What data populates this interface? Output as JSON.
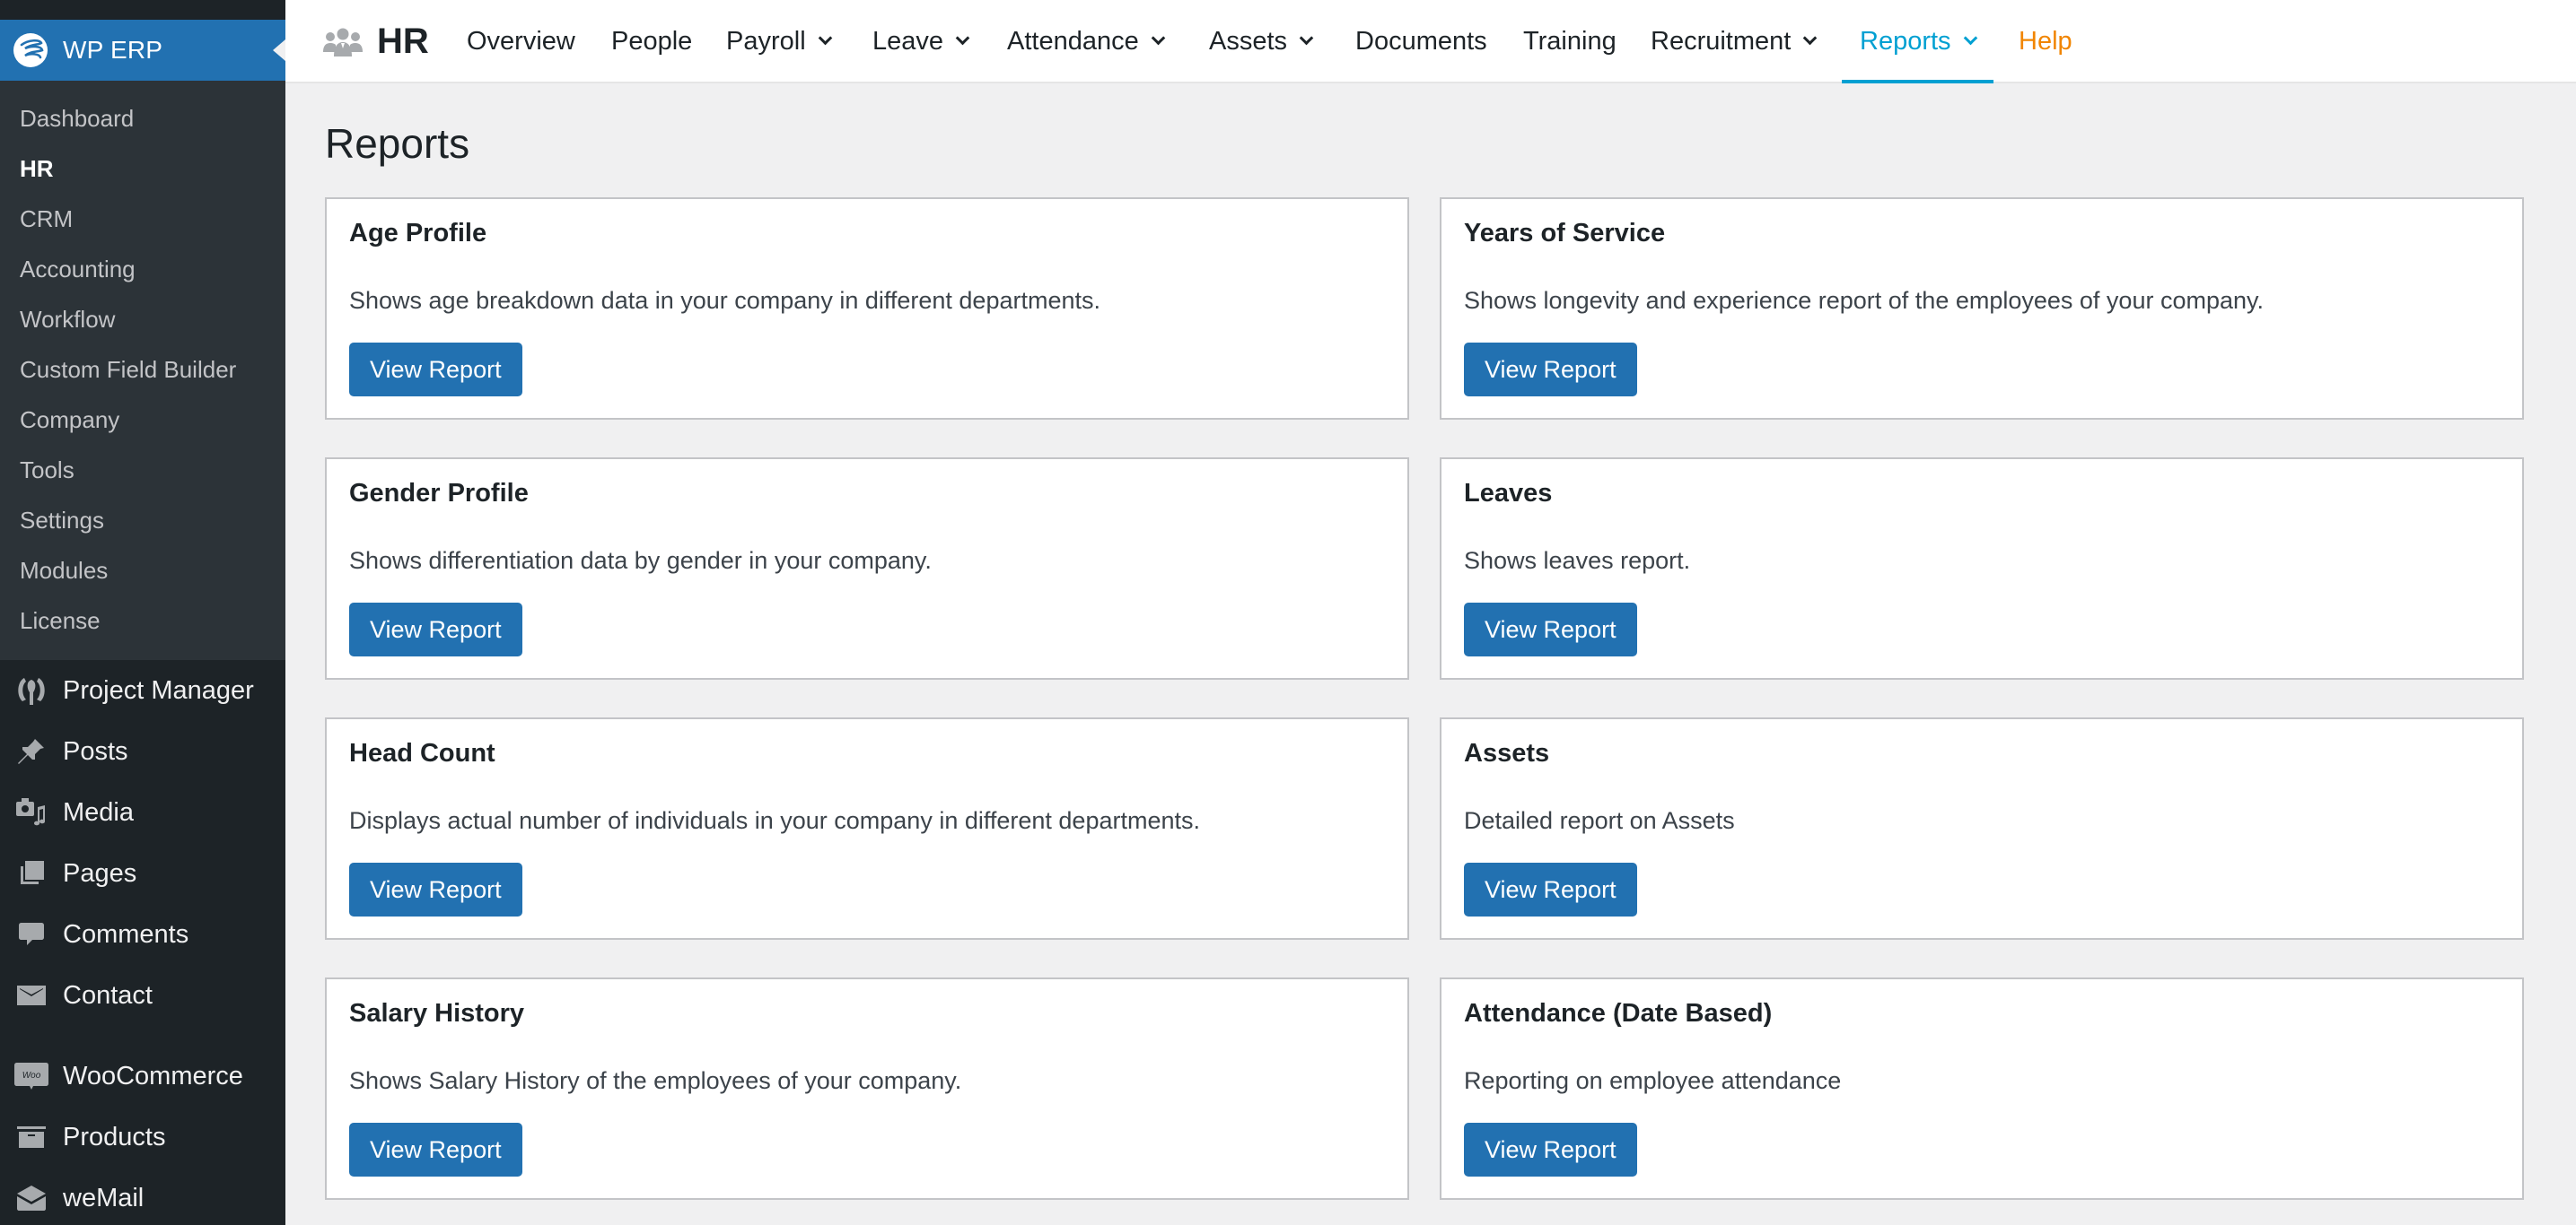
{
  "sidebar": {
    "erp_menu": {
      "label": "WP ERP",
      "icon": "wp-erp-logo-icon"
    },
    "submenu": [
      {
        "label": "Dashboard"
      },
      {
        "label": "HR",
        "current": true
      },
      {
        "label": "CRM"
      },
      {
        "label": "Accounting"
      },
      {
        "label": "Workflow"
      },
      {
        "label": "Custom Field Builder"
      },
      {
        "label": "Company"
      },
      {
        "label": "Tools"
      },
      {
        "label": "Settings"
      },
      {
        "label": "Modules"
      },
      {
        "label": "License"
      }
    ],
    "menu": [
      {
        "label": "Project Manager",
        "icon": "project-manager-icon"
      },
      {
        "label": "Posts",
        "icon": "pushpin-icon"
      },
      {
        "label": "Media",
        "icon": "media-icon"
      },
      {
        "label": "Pages",
        "icon": "pages-icon"
      },
      {
        "label": "Comments",
        "icon": "comment-icon"
      },
      {
        "label": "Contact",
        "icon": "envelope-icon"
      },
      {
        "label": "WooCommerce",
        "icon": "woocommerce-icon"
      },
      {
        "label": "Products",
        "icon": "archive-box-icon"
      },
      {
        "label": "weMail",
        "icon": "wemail-icon"
      }
    ]
  },
  "header": {
    "brand": "HR",
    "brand_icon": "people-group-icon",
    "nav": [
      {
        "label": "Overview",
        "dropdown": false
      },
      {
        "label": "People",
        "dropdown": false
      },
      {
        "label": "Payroll",
        "dropdown": true
      },
      {
        "label": "Leave",
        "dropdown": true
      },
      {
        "label": "Attendance",
        "dropdown": true
      },
      {
        "label": "Assets",
        "dropdown": true
      },
      {
        "label": "Documents",
        "dropdown": false
      },
      {
        "label": "Training",
        "dropdown": false
      },
      {
        "label": "Recruitment",
        "dropdown": true
      },
      {
        "label": "Reports",
        "dropdown": true,
        "active": true
      },
      {
        "label": "Help",
        "dropdown": false
      }
    ]
  },
  "colors": {
    "accent": "#00a0d2",
    "help": "#f18500",
    "button": "#2271b1",
    "sidebar_bg": "#1d2327",
    "submenu_bg": "#2c3338"
  },
  "main": {
    "title": "Reports",
    "reports": [
      {
        "title": "Age Profile",
        "description": "Shows age breakdown data in your company in different departments.",
        "button": "View Report"
      },
      {
        "title": "Years of Service",
        "description": "Shows longevity and experience report of the employees of your company.",
        "button": "View Report"
      },
      {
        "title": "Gender Profile",
        "description": "Shows differentiation data by gender in your company.",
        "button": "View Report"
      },
      {
        "title": "Leaves",
        "description": "Shows leaves report.",
        "button": "View Report"
      },
      {
        "title": "Head Count",
        "description": "Displays actual number of individuals in your company in different departments.",
        "button": "View Report"
      },
      {
        "title": "Assets",
        "description": "Detailed report on Assets",
        "button": "View Report"
      },
      {
        "title": "Salary History",
        "description": "Shows Salary History of the employees of your company.",
        "button": "View Report"
      },
      {
        "title": "Attendance (Date Based)",
        "description": "Reporting on employee attendance",
        "button": "View Report"
      }
    ]
  }
}
